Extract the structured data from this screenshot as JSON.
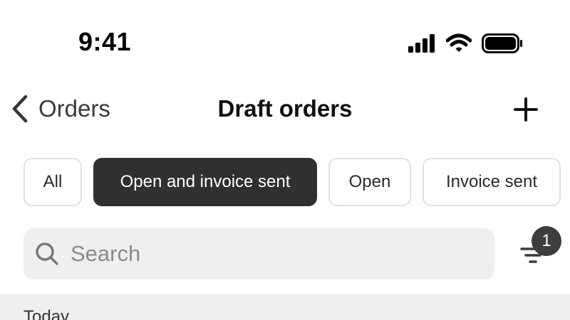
{
  "status_bar": {
    "time": "9:41",
    "icons": [
      "cellular-signal-icon",
      "wifi-icon",
      "battery-icon"
    ]
  },
  "nav": {
    "back_label": "Orders",
    "title": "Draft orders",
    "back_icon": "chevron-left-icon",
    "add_icon": "plus-icon"
  },
  "filters": {
    "chips": [
      {
        "label": "All",
        "active": false
      },
      {
        "label": "Open and invoice sent",
        "active": true
      },
      {
        "label": "Open",
        "active": false
      },
      {
        "label": "Invoice sent",
        "active": false
      }
    ]
  },
  "search": {
    "placeholder": "Search",
    "value": "",
    "icon": "search-icon"
  },
  "filter_button": {
    "icon": "filter-icon",
    "badge_count": "1"
  },
  "list": {
    "section_label": "Today"
  },
  "colors": {
    "active_chip_bg": "#303030",
    "search_bg": "#efefef",
    "badge_bg": "#3d3d3d",
    "section_bg": "#efefef"
  }
}
